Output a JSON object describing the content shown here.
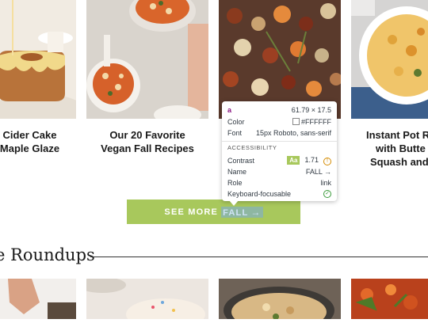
{
  "cards": [
    {
      "title_lines": [
        "Cider Cake",
        "Maple Glaze"
      ]
    },
    {
      "title_lines": [
        "Our 20 Favorite",
        "Vegan Fall Recipes"
      ]
    },
    {
      "title_lines": [
        "",
        ""
      ]
    },
    {
      "title_lines": [
        "Instant Pot R",
        "with Butte",
        "Squash and"
      ]
    }
  ],
  "see_more": {
    "label": "SEE MORE",
    "highlight": "FALL",
    "arrow": "→"
  },
  "inspector": {
    "tag": "a",
    "size": "61.79 × 17.5",
    "color_label": "Color",
    "color_value": "#FFFFFF",
    "font_label": "Font",
    "font_value": "15px Roboto, sans-serif",
    "section": "ACCESSIBILITY",
    "contrast_label": "Contrast",
    "contrast_badge": "Aa",
    "contrast_value": "1.71",
    "name_label": "Name",
    "name_value": "FALL →",
    "role_label": "Role",
    "role_value": "link",
    "focus_label": "Keyboard-focusable",
    "warn_icon": "!",
    "check_icon": "✓"
  },
  "section_heading": "e Roundups",
  "colors": {
    "accent": "#a8c85c",
    "text": "#1a1a1a",
    "tag": "#881280"
  }
}
